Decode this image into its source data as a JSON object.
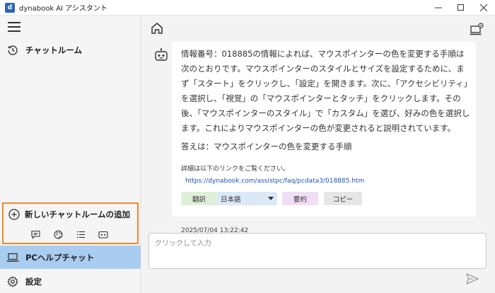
{
  "app": {
    "title": "dynabook AI アシスタント"
  },
  "sidebar": {
    "chat_room_label": "チャットルーム",
    "new_room_label": "新しいチャットルームの追加",
    "pc_help_label": "PCヘルプチャット",
    "settings_label": "設定"
  },
  "message": {
    "body": "情報番号：018885の情報によれば、マウスポインターの色を変更する手順は次のとおりです。マウスポインターのスタイルとサイズを設定するために、まず「スタート」をクリックし、「設定」を開きます。次に、「アクセシビリティ」を選択し、「視覚」の「マウスポインターとタッチ」をクリックします。その後、「マウスポインターのスタイル」で「カスタム」を選び、好みの色を選択します。これによりマウスポインターの色が変更されると説明されています。",
    "answer": "答えは：マウスポインターの色を変更する手順",
    "detail_text": "詳細は以下のリンクをご覧ください。",
    "link": "https://dynabook.com/assistpc/faq/pcdata3/018885.htm",
    "translate_label": "翻訳",
    "language": "日本語",
    "summary_label": "要約",
    "copy_label": "コピー",
    "timestamp": "2025/07/04 13:22:42"
  },
  "input": {
    "placeholder": "クリックして入力"
  },
  "colors": {
    "highlight_border": "#f0892b",
    "active_item": "#a9cdf0",
    "link": "#1a56b8",
    "translate_btn": "#dff0d8",
    "summary_btn": "#efdef5"
  },
  "icons": {
    "app": "dynabook-app-icon",
    "menu": "hamburger-icon",
    "history": "history-icon",
    "add": "plus-circle-icon",
    "chat": "chat-bubble-icon",
    "globe": "globe-icon",
    "list": "list-icon",
    "robot": "robot-icon",
    "laptop": "laptop-icon",
    "gear": "gear-icon",
    "home": "home-icon",
    "pc_settings": "pc-settings-icon",
    "send": "send-icon"
  }
}
